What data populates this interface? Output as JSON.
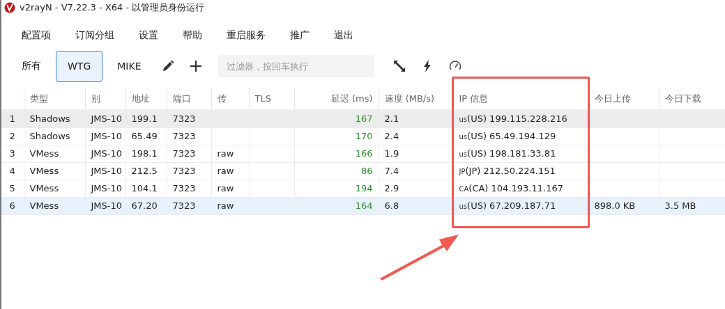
{
  "window": {
    "title": "v2rayN - V7.22.3 - X64 - 以管理员身份运行"
  },
  "menu": [
    "配置项",
    "订阅分组",
    "设置",
    "帮助",
    "重启服务",
    "推广",
    "退出"
  ],
  "groups": [
    {
      "label": "所有",
      "selected": false
    },
    {
      "label": "WTG",
      "selected": true
    },
    {
      "label": "MIKE",
      "selected": false
    }
  ],
  "filter": {
    "placeholder": "过滤器，按回车执行"
  },
  "table": {
    "columns": [
      "类型",
      "别",
      "地址",
      "端口",
      "传",
      "TLS",
      "延迟 (ms)",
      "速度 (MB/s)",
      "IP 信息",
      "今日上传",
      "今日下载"
    ],
    "rows": [
      {
        "index": "1",
        "cells": [
          "Shadows",
          "JMS-10",
          "199.1",
          "7323",
          "",
          "",
          "167",
          "2.1",
          "199.115.228.216",
          "",
          ""
        ],
        "country": "us",
        "country_label": "(US)",
        "selected": false,
        "hovered": true
      },
      {
        "index": "2",
        "cells": [
          "Shadows",
          "JMS-10",
          "65.49",
          "7323",
          "",
          "",
          "170",
          "2.4",
          "65.49.194.129",
          "",
          ""
        ],
        "country": "us",
        "country_label": "(US)",
        "selected": false,
        "hovered": false
      },
      {
        "index": "3",
        "cells": [
          "VMess",
          "JMS-10",
          "198.1",
          "7323",
          "raw",
          "",
          "166",
          "1.9",
          "198.181.33.81",
          "",
          ""
        ],
        "country": "us",
        "country_label": "(US)",
        "selected": false,
        "hovered": false
      },
      {
        "index": "4",
        "cells": [
          "VMess",
          "JMS-10",
          "212.5",
          "7323",
          "raw",
          "",
          "86",
          "7.4",
          "212.50.224.151",
          "",
          ""
        ],
        "country": "JP",
        "country_label": "(JP)",
        "selected": false,
        "hovered": false
      },
      {
        "index": "5",
        "cells": [
          "VMess",
          "JMS-10",
          "104.1",
          "7323",
          "raw",
          "",
          "194",
          "2.9",
          "104.193.11.167",
          "",
          ""
        ],
        "country": "CA",
        "country_label": "(CA)",
        "selected": false,
        "hovered": false
      },
      {
        "index": "6",
        "cells": [
          "VMess",
          "JMS-10",
          "67.20",
          "7323",
          "raw",
          "",
          "164",
          "6.8",
          "67.209.187.71",
          "898.0 KB",
          "3.5 MB"
        ],
        "country": "us",
        "country_label": "(US)",
        "selected": true,
        "hovered": false
      }
    ]
  }
}
